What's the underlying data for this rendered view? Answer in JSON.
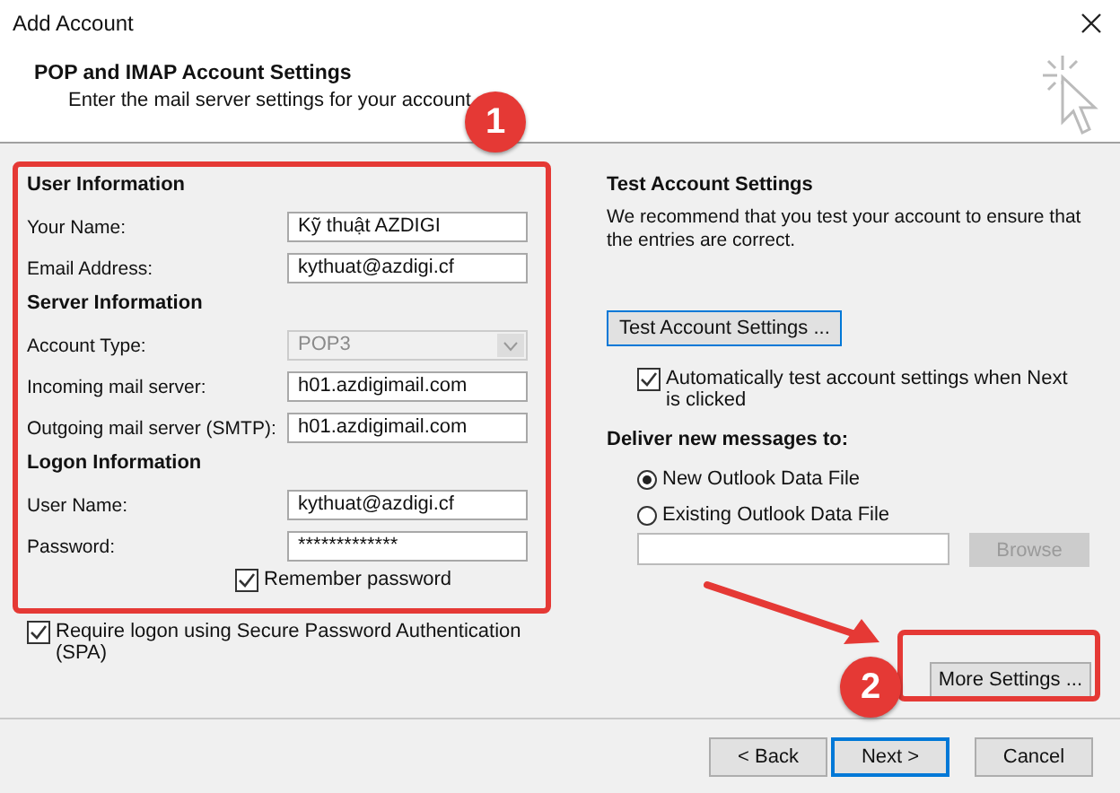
{
  "window": {
    "title": "Add Account"
  },
  "header": {
    "title": "POP and IMAP Account Settings",
    "subtitle": "Enter the mail server settings for your account."
  },
  "sections": [
    {
      "heading": "User Information",
      "fields": [
        {
          "label": "Your Name:",
          "kind": "text",
          "value": "Kỹ thuật AZDIGI",
          "disabled": false
        },
        {
          "label": "Email Address:",
          "kind": "text",
          "value": "kythuat@azdigi.cf",
          "disabled": false
        }
      ]
    },
    {
      "heading": "Server Information",
      "fields": [
        {
          "label": "Account Type:",
          "kind": "dropdown",
          "value": "POP3",
          "disabled": true
        },
        {
          "label": "Incoming mail server:",
          "kind": "text",
          "value": "h01.azdigimail.com",
          "disabled": false
        },
        {
          "label": "Outgoing mail server (SMTP):",
          "kind": "text",
          "value": "h01.azdigimail.com",
          "disabled": false
        }
      ]
    },
    {
      "heading": "Logon Information",
      "fields": [
        {
          "label": "User Name:",
          "kind": "text",
          "value": "kythuat@azdigi.cf",
          "disabled": false
        },
        {
          "label": "Password:",
          "kind": "password",
          "value": "*************",
          "disabled": false
        }
      ]
    }
  ],
  "remember_password": {
    "label": "Remember password",
    "checked": true
  },
  "require_spa": {
    "label": "Require logon using Secure Password Authentication (SPA)",
    "checked": true
  },
  "test_settings": {
    "heading": "Test Account Settings",
    "description": "We recommend that you test your account to ensure that the entries are correct.",
    "button": "Test Account Settings ...",
    "auto_test": {
      "label": "Automatically test account settings when Next is clicked",
      "checked": true
    }
  },
  "deliver": {
    "heading": "Deliver new messages to:",
    "options": [
      {
        "label": "New Outlook Data File",
        "selected": true
      },
      {
        "label": "Existing Outlook Data File",
        "selected": false
      }
    ],
    "browse_button": {
      "label": "Browse",
      "disabled": true
    }
  },
  "more_settings_button": "More Settings ...",
  "buttons": [
    {
      "label": "< Back",
      "default": false
    },
    {
      "label": "Next >",
      "default": true
    },
    {
      "label": "Cancel",
      "default": false
    }
  ],
  "annotations": [
    "1",
    "2"
  ]
}
